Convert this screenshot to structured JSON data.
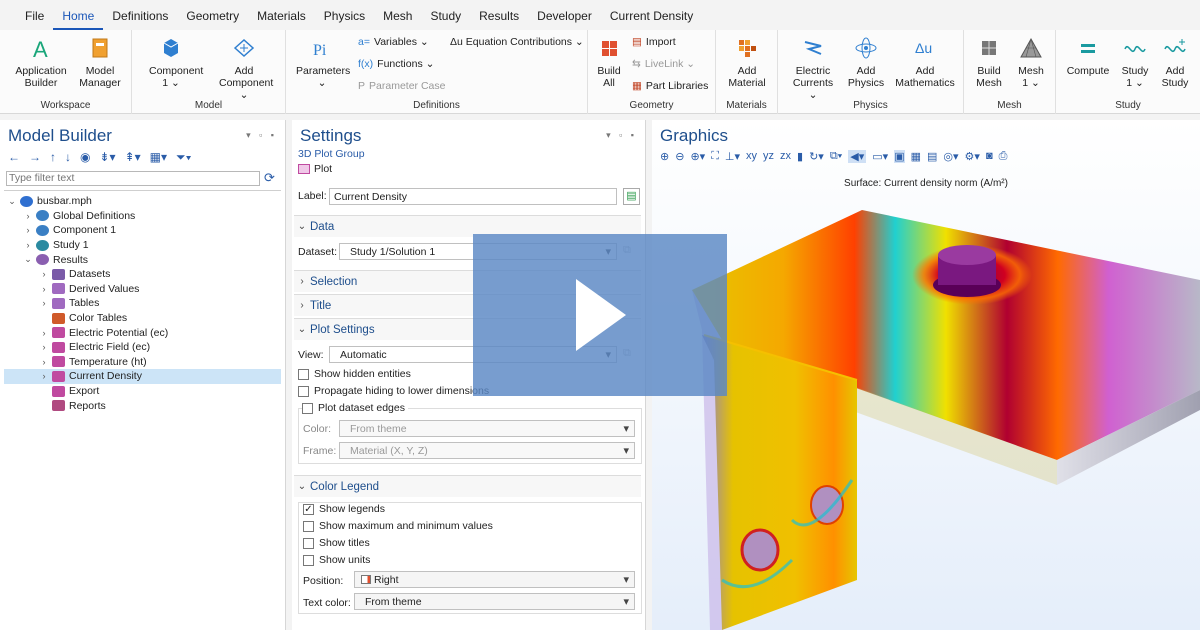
{
  "menu": [
    "File",
    "Home",
    "Definitions",
    "Geometry",
    "Materials",
    "Physics",
    "Mesh",
    "Study",
    "Results",
    "Developer",
    "Current Density"
  ],
  "menu_active": "Home",
  "ribbon": {
    "workspace": {
      "label": "Workspace",
      "app_builder": "Application Builder",
      "model_manager": "Model Manager"
    },
    "model": {
      "label": "Model",
      "component": "Component 1 ⌄",
      "add_component": "Add Component ⌄"
    },
    "definitions": {
      "label": "Definitions",
      "parameters": "Parameters ⌄",
      "variables": "Variables ⌄",
      "functions": "Functions ⌄",
      "parameter_case": "Parameter Case",
      "au_contrib": "Δu Equation Contributions ⌄"
    },
    "geometry": {
      "label": "Geometry",
      "build_all": "Build All",
      "import": "Import",
      "livelink": "LiveLink ⌄",
      "part_libraries": "Part Libraries"
    },
    "materials": {
      "label": "Materials",
      "add_material": "Add Material"
    },
    "physics": {
      "label": "Physics",
      "electric_currents": "Electric Currents ⌄",
      "add_physics": "Add Physics",
      "add_math": "Add Mathematics"
    },
    "mesh": {
      "label": "Mesh",
      "build_mesh": "Build Mesh",
      "mesh1": "Mesh 1 ⌄"
    },
    "study": {
      "label": "Study",
      "compute": "Compute",
      "study1": "Study 1 ⌄",
      "add_study": "Add Study"
    }
  },
  "model_builder": {
    "title": "Model Builder",
    "filter_placeholder": "Type filter text",
    "tree": [
      {
        "label": "busbar.mph",
        "level": 0,
        "tw": "⌄",
        "color": "#2f6fd0"
      },
      {
        "label": "Global Definitions",
        "level": 1,
        "tw": "›",
        "color": "#3a7fc4"
      },
      {
        "label": "Component 1",
        "level": 1,
        "tw": "›",
        "color": "#3a7fc4"
      },
      {
        "label": "Study 1",
        "level": 1,
        "tw": "›",
        "color": "#2a8aa0"
      },
      {
        "label": "Results",
        "level": 1,
        "tw": "⌄",
        "color": "#8a5fb0"
      },
      {
        "label": "Datasets",
        "level": 2,
        "tw": "›",
        "color": "#7a5aa8"
      },
      {
        "label": "Derived Values",
        "level": 2,
        "tw": "›",
        "color": "#a06ac0"
      },
      {
        "label": "Tables",
        "level": 2,
        "tw": "›",
        "color": "#a06ac0"
      },
      {
        "label": "Color Tables",
        "level": 2,
        "tw": "",
        "color": "#d05a2a"
      },
      {
        "label": "Electric Potential (ec)",
        "level": 2,
        "tw": "›",
        "color": "#c04aa0"
      },
      {
        "label": "Electric Field (ec)",
        "level": 2,
        "tw": "›",
        "color": "#c04aa0"
      },
      {
        "label": "Temperature (ht)",
        "level": 2,
        "tw": "›",
        "color": "#c04aa0"
      },
      {
        "label": "Current Density",
        "level": 2,
        "tw": "›",
        "color": "#c04aa0",
        "selected": true
      },
      {
        "label": "Export",
        "level": 2,
        "tw": "",
        "color": "#c04aa0"
      },
      {
        "label": "Reports",
        "level": 2,
        "tw": "",
        "color": "#b04a80"
      }
    ]
  },
  "settings": {
    "title": "Settings",
    "subtitle": "3D Plot Group",
    "plot_label": "Plot",
    "label_caption": "Label:",
    "label_value": "Current Density",
    "sections": {
      "data": "Data",
      "selection": "Selection",
      "title": "Title",
      "plot_settings": "Plot Settings",
      "color_legend": "Color Legend"
    },
    "dataset_caption": "Dataset:",
    "dataset_value": "Study 1/Solution 1",
    "view_caption": "View:",
    "view_value": "Automatic",
    "show_hidden": "Show hidden entities",
    "propagate": "Propagate hiding to lower dimensions",
    "plot_edges": "Plot dataset edges",
    "color_caption": "Color:",
    "color_value": "From theme",
    "frame_caption": "Frame:",
    "frame_value": "Material  (X, Y, Z)",
    "show_legends": "Show legends",
    "show_maxmin": "Show maximum and minimum values",
    "show_titles": "Show titles",
    "show_units": "Show units",
    "position_caption": "Position:",
    "position_value": "Right",
    "textcolor_caption": "Text color:",
    "textcolor_value": "From theme"
  },
  "graphics": {
    "title": "Graphics",
    "surface_title": "Surface: Current density norm (A/m²)"
  }
}
